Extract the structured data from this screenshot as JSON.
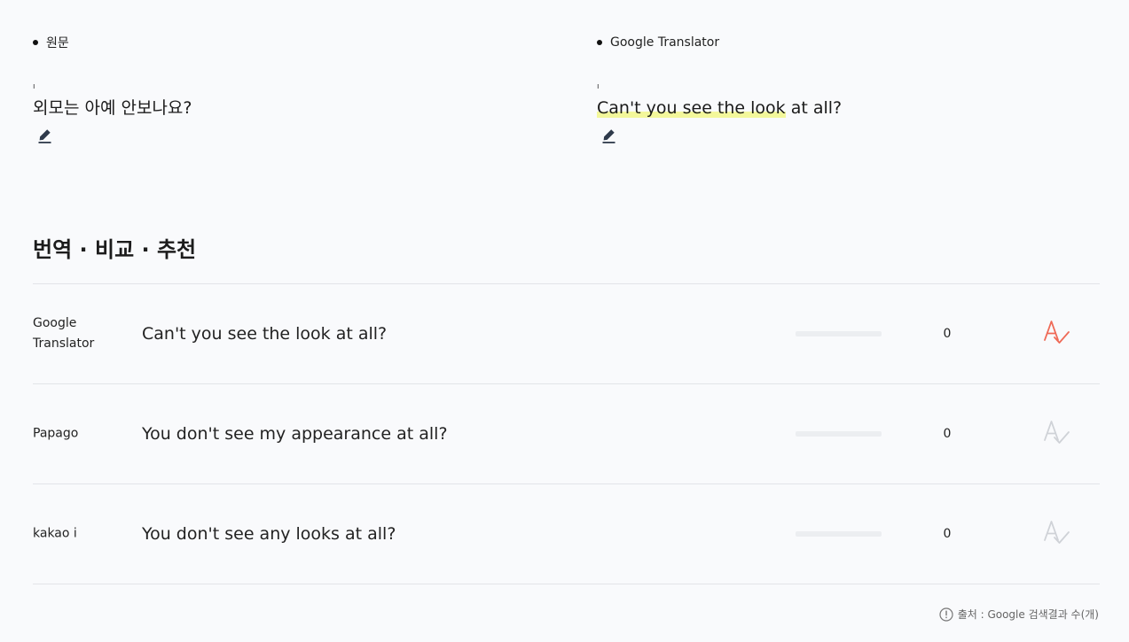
{
  "source_panel": {
    "label": "원문",
    "tick": "ı",
    "text": "외모는 아예 안보나요?"
  },
  "translation_panel": {
    "label": "Google Translator",
    "tick": "ı",
    "text_highlighted": "Can't you see the look",
    "text_rest": " at all?"
  },
  "section": {
    "title": "번역 · 비교 · 추천"
  },
  "results": [
    {
      "engine": "Google Translator",
      "text": "Can't you see the look at all?",
      "count": "0",
      "recommended": true
    },
    {
      "engine": "Papago",
      "text": "You don't see my appearance at all?",
      "count": "0",
      "recommended": false
    },
    {
      "engine": "kakao i",
      "text": "You don't see any looks at all?",
      "count": "0",
      "recommended": false
    }
  ],
  "footer": {
    "source_note": "출처 : Google 검색결과 수(개)"
  },
  "colors": {
    "recommend_active": "#ef6a57",
    "recommend_inactive": "#cfd2d7",
    "highlight": "#f3f79b"
  },
  "icons": {
    "edit": "pencil-icon",
    "recommend": "spellcheck-icon",
    "info": "info-icon"
  }
}
